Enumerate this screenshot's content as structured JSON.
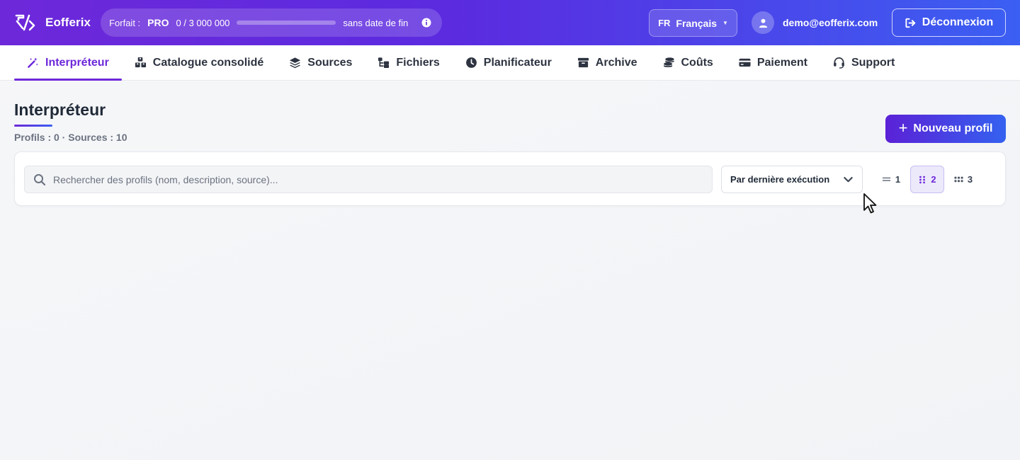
{
  "app": {
    "name": "Eofferix"
  },
  "plan": {
    "label": "Forfait :",
    "tier": "PRO",
    "usage": "0 / 3 000 000",
    "usage_fraction": 0,
    "end": "sans date de fin"
  },
  "language": {
    "code": "FR",
    "name": "Français"
  },
  "user": {
    "email": "demo@eofferix.com"
  },
  "logout": {
    "label": "Déconnexion"
  },
  "nav": {
    "tabs": [
      {
        "label": "Interpréteur",
        "icon": "magic-wand-icon"
      },
      {
        "label": "Catalogue consolidé",
        "icon": "boxes-icon"
      },
      {
        "label": "Sources",
        "icon": "layers-icon"
      },
      {
        "label": "Fichiers",
        "icon": "folder-tree-icon"
      },
      {
        "label": "Planificateur",
        "icon": "clock-icon"
      },
      {
        "label": "Archive",
        "icon": "archive-icon"
      },
      {
        "label": "Coûts",
        "icon": "coins-icon"
      },
      {
        "label": "Paiement",
        "icon": "credit-card-icon"
      },
      {
        "label": "Support",
        "icon": "headset-icon"
      }
    ]
  },
  "page": {
    "title": "Interpréteur",
    "subtitle": "Profils : 0 · Sources : 10",
    "new_button": "Nouveau profil"
  },
  "filters": {
    "search_placeholder": "Rechercher des profils (nom, description, source)...",
    "sort_value": "Par dernière exécution",
    "columns": [
      "1",
      "2",
      "3"
    ],
    "active_columns": "2"
  },
  "colors": {
    "accent": "#6d28d9",
    "accent_secondary": "#3b5ff2"
  }
}
